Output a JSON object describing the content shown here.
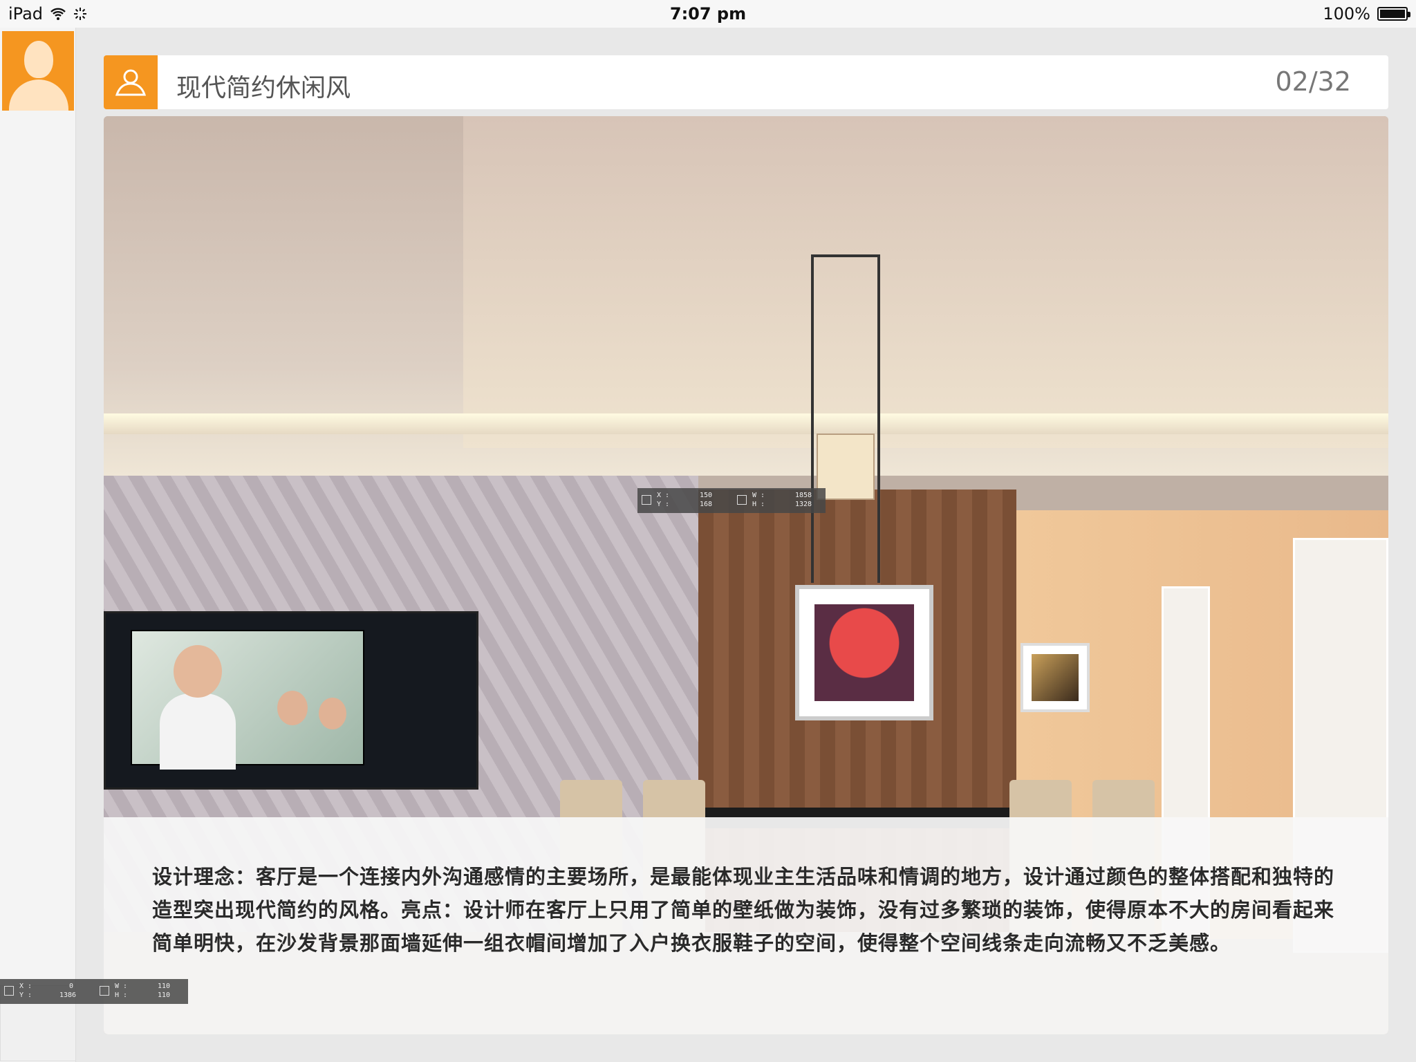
{
  "statusbar": {
    "device": "iPad",
    "time": "7:07 pm",
    "battery": "100%",
    "battery_level": 1.0
  },
  "sidebar": {
    "avatar_icon": "user-silhouette-icon"
  },
  "header": {
    "badge_icon": "user-outline-icon",
    "title": "现代简约休闲风",
    "counter": "02/32"
  },
  "caption": {
    "text": "设计理念：客厅是一个连接内外沟通感情的主要场所，是最能体现业主生活品味和情调的地方，设计通过颜色的整体搭配和独特的造型突出现代简约的风格。亮点：设计师在客厅上只用了简单的壁纸做为装饰，没有过多繁琐的装饰，使得原本不大的房间看起来简单明快，在沙发背景那面墙延伸一组衣帽间增加了入户换衣服鞋子的空间，使得整个空间线条走向流畅又不乏美感。"
  },
  "overlay_main": {
    "x_label": "X :",
    "y_label": "Y :",
    "x": "150",
    "y": "168",
    "w_label": "W :",
    "h_label": "H :",
    "w": "1858",
    "h": "1328"
  },
  "overlay_side": {
    "x_label": "X :",
    "y_label": "Y :",
    "x": "0",
    "y": "1386",
    "w_label": "W :",
    "h_label": "H :",
    "w": "110",
    "h": "110"
  },
  "colors": {
    "accent": "#f59620",
    "header_bg": "#ffffff",
    "page_bg": "#e8e8e8"
  }
}
